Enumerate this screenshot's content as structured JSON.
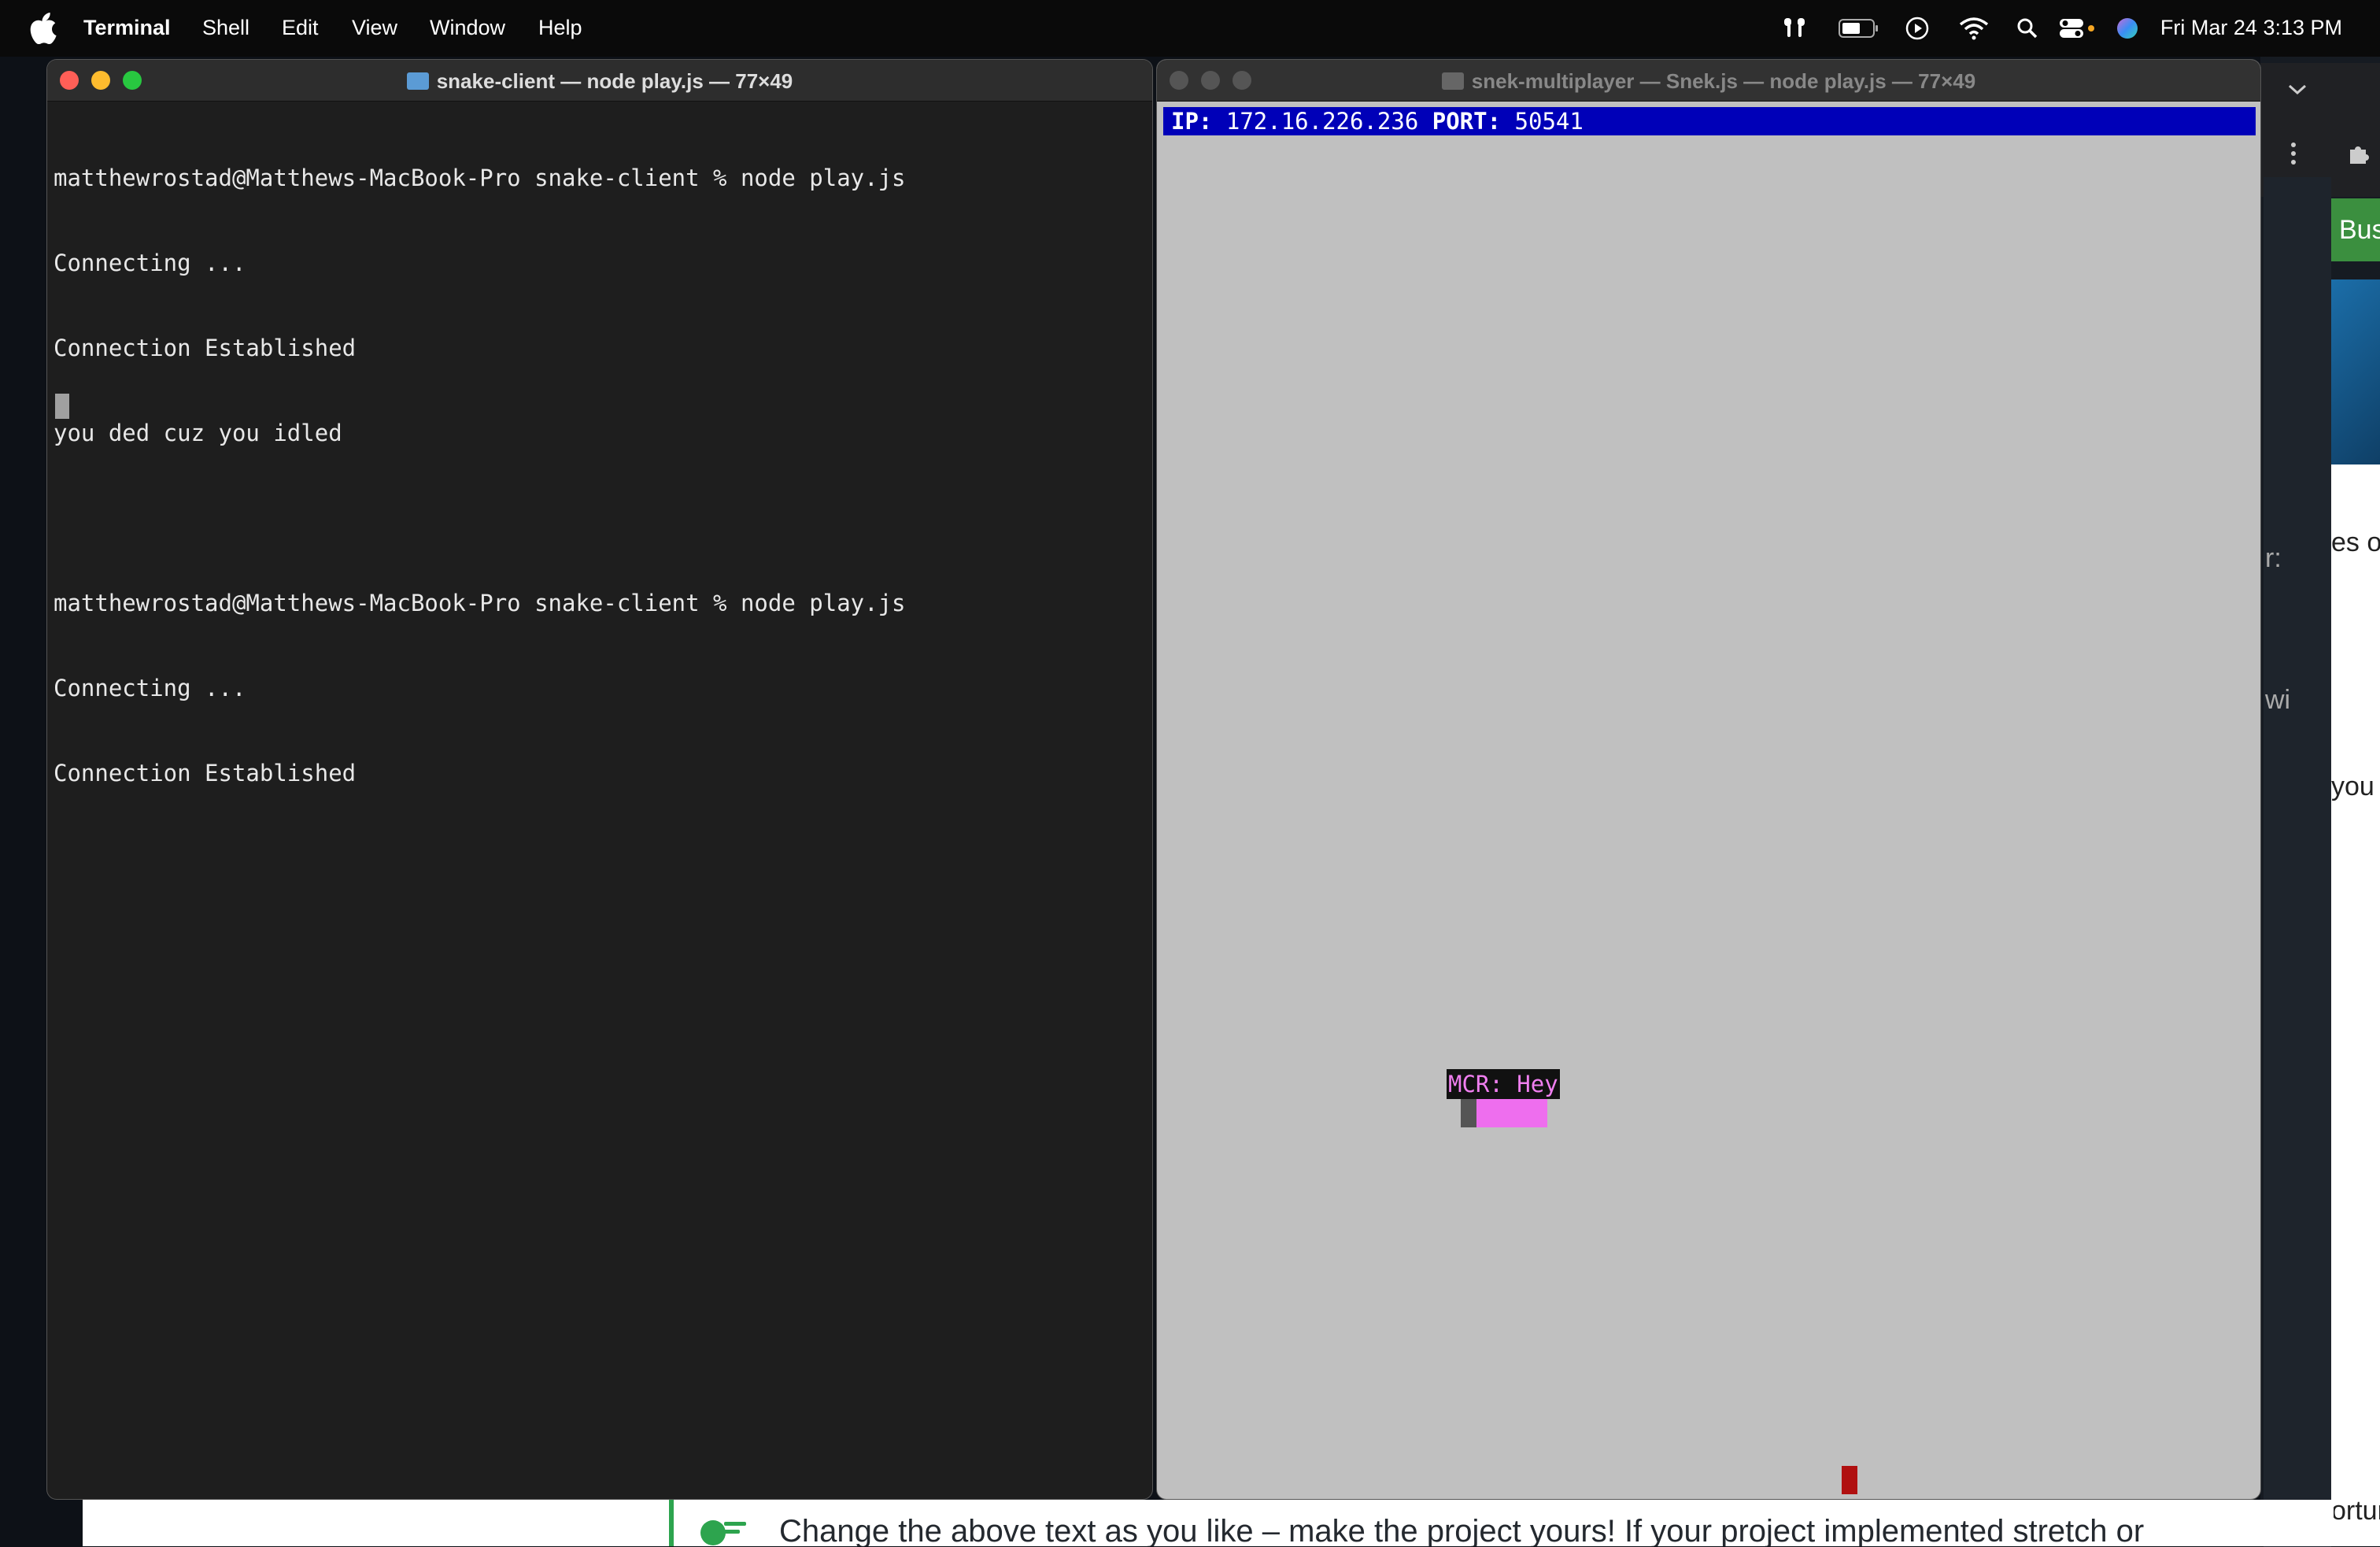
{
  "menubar": {
    "app_name": "Terminal",
    "menus": [
      "Shell",
      "Edit",
      "View",
      "Window",
      "Help"
    ],
    "clock": "Fri Mar 24  3:13 PM"
  },
  "background_browser": {
    "green_label": "Bus",
    "fragments": [
      "es of",
      "r:",
      "wi",
      "you",
      "ortur"
    ],
    "bottom_text": "Change the above text as you like – make the project yours! If your project implemented stretch or"
  },
  "window_left": {
    "title": "snake-client — node play.js — 77×49",
    "lines": [
      "matthewrostad@Matthews-MacBook-Pro snake-client % node play.js",
      "Connecting ...",
      "Connection Established",
      "you ded cuz you idled",
      "",
      "matthewrostad@Matthews-MacBook-Pro snake-client % node play.js",
      "Connecting ...",
      "Connection Established"
    ]
  },
  "window_right": {
    "title": "snek-multiplayer — Snek.js — node play.js — 77×49",
    "ip_label": "IP:",
    "ip_value": "172.16.226.236",
    "port_label": "PORT:",
    "port_value": "50541",
    "chat_message": "MCR: Hey"
  },
  "colors": {
    "terminal_bg": "#1e1e1e",
    "game_bg": "#c0c0c0",
    "status_bar": "#0000b8",
    "snake_body": "#ee6eee",
    "food": "#b01010"
  }
}
